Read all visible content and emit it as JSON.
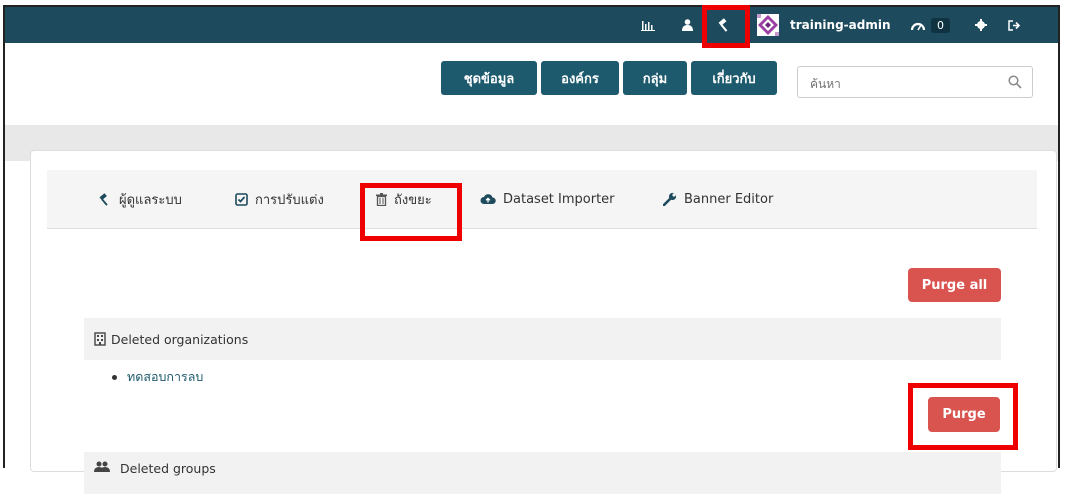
{
  "topbar": {
    "username": "training-admin",
    "dashboard_count": "0",
    "icons": [
      "chart-icon",
      "user-icon",
      "gavel-icon",
      "avatar",
      "dashboard-icon",
      "gear-icon",
      "sign-out-icon"
    ]
  },
  "nav": {
    "items": [
      {
        "label": "ชุดข้อมูล"
      },
      {
        "label": "องค์กร"
      },
      {
        "label": "กลุ่ม"
      },
      {
        "label": "เกี่ยวกับ"
      }
    ],
    "search_placeholder": "ค้นหา"
  },
  "admin_tabs": [
    {
      "label": "ผู้ดูแลระบบ",
      "icon": "gavel-icon"
    },
    {
      "label": "การปรับแต่ง",
      "icon": "check-square-icon"
    },
    {
      "label": "ถังขยะ",
      "icon": "trash-icon"
    },
    {
      "label": "Dataset Importer",
      "icon": "cloud-upload-icon"
    },
    {
      "label": "Banner Editor",
      "icon": "wrench-icon"
    }
  ],
  "trash": {
    "purge_all_label": "Purge all",
    "deleted_organizations": {
      "heading": "Deleted organizations",
      "items": [
        "ทดสอบการลบ"
      ],
      "purge_label": "Purge"
    },
    "deleted_groups": {
      "heading": "Deleted groups"
    }
  },
  "colors": {
    "topbar": "#1d4a5c",
    "nav_button": "#1d5a6e",
    "danger": "#d9534f",
    "highlight": "#ee0000"
  }
}
